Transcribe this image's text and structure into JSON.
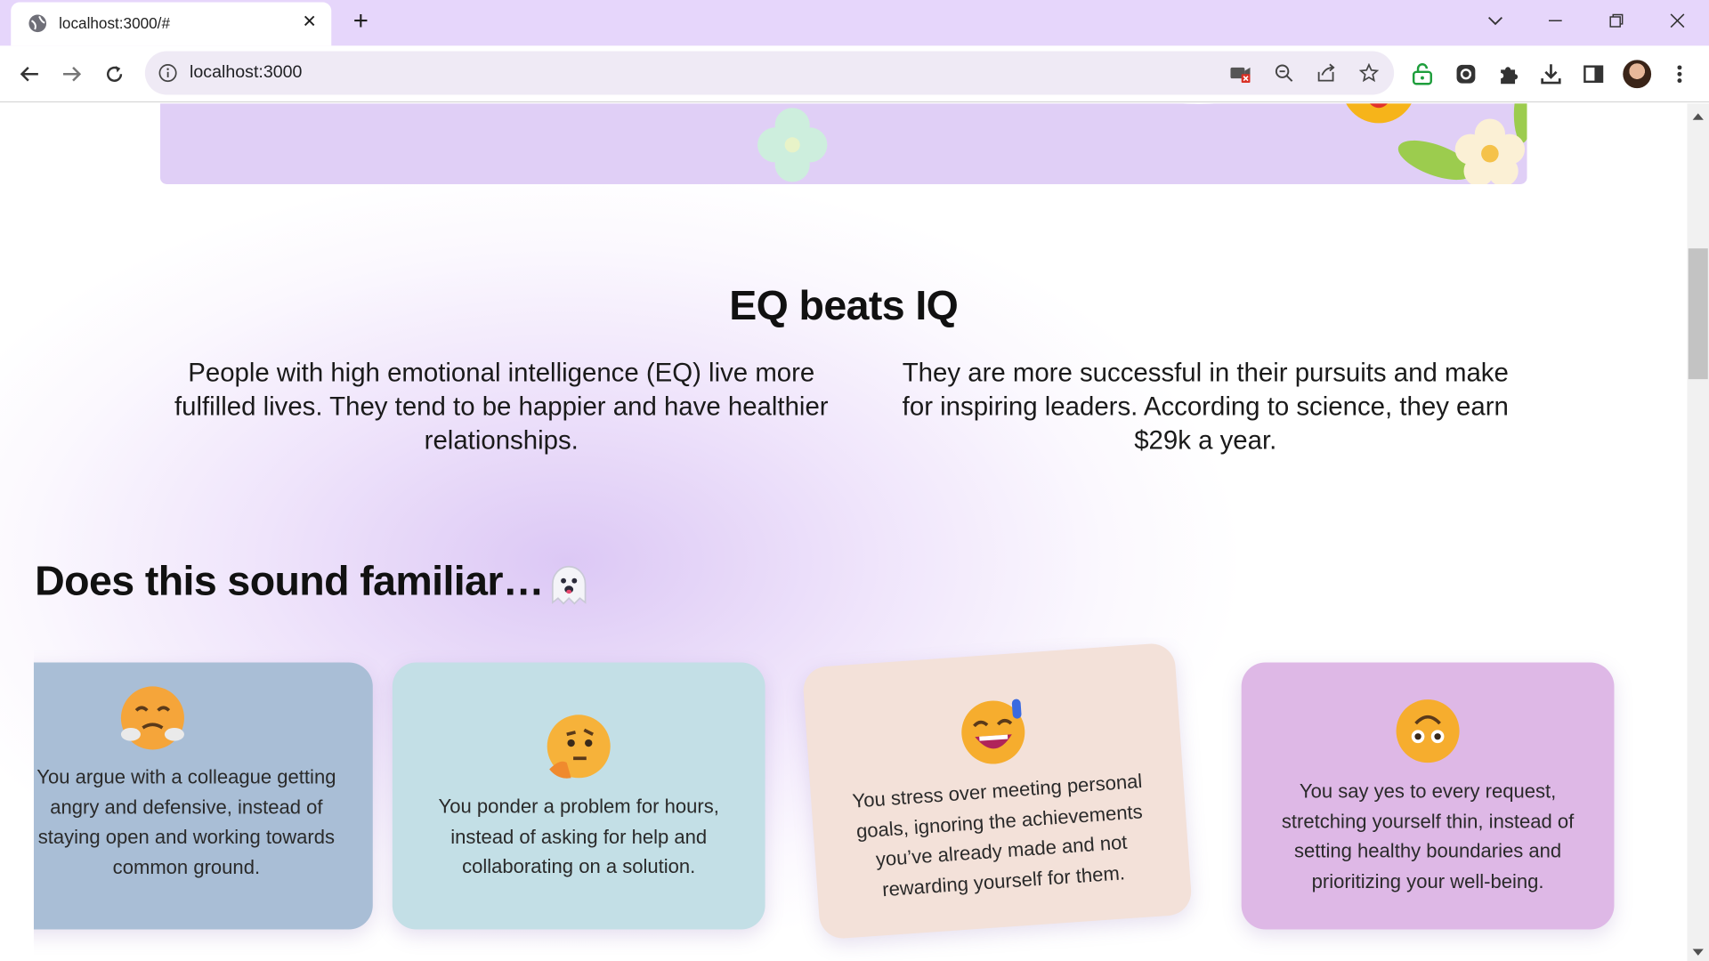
{
  "browser": {
    "tab_title": "localhost:3000/#",
    "close_glyph": "✕",
    "new_tab_glyph": "+",
    "url": "localhost:3000",
    "icons": [
      "globe-icon",
      "back-icon",
      "forward-icon",
      "reload-icon",
      "info-icon",
      "camera-blocked-icon",
      "zoom-out-icon",
      "share-icon",
      "star-icon",
      "lock-extension-icon",
      "record-extension-icon",
      "puzzle-icon",
      "download-icon",
      "sidepanel-icon",
      "profile-avatar",
      "menu-icon"
    ]
  },
  "page": {
    "section_title": "EQ beats IQ",
    "para_left": "People with high emotional intelligence (EQ) live more fulfilled lives. They tend to be happier and have healthier relationships.",
    "para_right": "They are more successful in their pursuits and make for inspiring leaders. According to science, they earn $29k a year.",
    "familiar_title": "Does this sound familiar…",
    "familiar_icon": "ghost-emoji",
    "cards": [
      {
        "text": "You argue with a colleague getting angry and defensive, instead of staying open and working towards common ground.",
        "emoji": "steaming-face",
        "bg": "#a9bed6"
      },
      {
        "text": "You ponder a problem for hours, instead of asking for help and collaborating on a solution.",
        "emoji": "thinking-face",
        "bg": "#c3dfe6"
      },
      {
        "text": "You stress over meeting personal goals, ignoring the achievements you’ve already made and not rewarding yourself for them.",
        "emoji": "sweat-smile-face",
        "bg": "#f3e1d9"
      },
      {
        "text": "You say yes to every request, stretching yourself thin, instead of setting healthy boundaries and prioritizing your well-being.",
        "emoji": "upside-down-face",
        "bg": "#deb8e6"
      }
    ]
  },
  "colors": {
    "tabstrip": "#e6d6fb",
    "banner": "#e0cff6",
    "heading": "#111111"
  }
}
